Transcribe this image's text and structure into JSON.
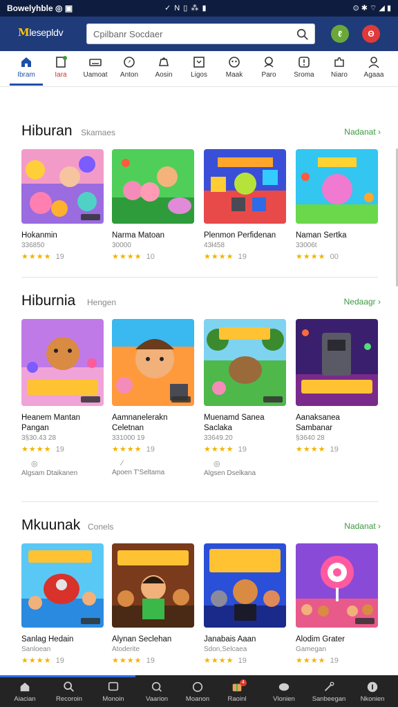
{
  "status_bar": {
    "left": "Bowelyhble ◎ ▣",
    "middle": "✓ N ▯ ⁂ ▮",
    "right": "⊙ ✱ ⌔ ◢ ▮"
  },
  "app_bar": {
    "logo_letters": "M",
    "logo_rest": "lesepldv",
    "search_placeholder": "Cpilbanr Socdaer",
    "right_buttons": [
      "ℓ",
      "Θ"
    ]
  },
  "categories": [
    {
      "label": "Ibram",
      "icon": "home-icon"
    },
    {
      "label": "Iara",
      "icon": "doc-icon"
    },
    {
      "label": "Uamoat",
      "icon": "keyboard-icon"
    },
    {
      "label": "Anton",
      "icon": "compass-icon"
    },
    {
      "label": "Aosin",
      "icon": "bag-icon"
    },
    {
      "label": "Ligos",
      "icon": "grid-icon"
    },
    {
      "label": "Maak",
      "icon": "mask-icon"
    },
    {
      "label": "Paro",
      "icon": "person-icon"
    },
    {
      "label": "Sroma",
      "icon": "info-icon"
    },
    {
      "label": "Niaro",
      "icon": "puzzle-icon"
    },
    {
      "label": "Agaaa",
      "icon": "user-icon"
    }
  ],
  "sections": [
    {
      "title": "Hiburan",
      "subtitle": "Skamaes",
      "more": "Nadanat",
      "cards": [
        {
          "name": "Hokanmin",
          "meta": "336850",
          "stars": "★★★★",
          "rating": "19",
          "art": "pink"
        },
        {
          "name": "Narma Matoan",
          "meta": "30000",
          "stars": "★★★★",
          "rating": "10",
          "art": "green"
        },
        {
          "name": "Plenmon Perfidenan",
          "meta": "43ł458",
          "stars": "★★★★",
          "rating": "19",
          "art": "blocks"
        },
        {
          "name": "Naman Sertka",
          "meta": "33006t",
          "stars": "★★★★",
          "rating": "00",
          "art": "cyan"
        }
      ]
    },
    {
      "title": "Hiburnia",
      "subtitle": "Hengen",
      "more": "Nedaagr",
      "cards": [
        {
          "name": "Heanem Mantan Pangan",
          "meta": "3§30.43 28",
          "stars": "★★★★",
          "rating": "19",
          "art": "bear",
          "foot_icon": "◎",
          "foot": "Algsam Dtaikanen"
        },
        {
          "name": "Aamnanelerakn Celetnan",
          "meta": "331000 19",
          "stars": "★★★★",
          "rating": "19",
          "art": "boy",
          "foot_icon": "⁄",
          "foot": "Apoen T'Seltama"
        },
        {
          "name": "Muenamd Sanea Saclaka",
          "meta": "33649.20",
          "stars": "★★★★",
          "rating": "19",
          "art": "forest",
          "foot_icon": "◎",
          "foot": "Algsen Dselkana"
        },
        {
          "name": "Aanaksanea Sambanar",
          "meta": "§3640 28",
          "stars": "★★★★",
          "rating": "19",
          "art": "robot"
        }
      ]
    },
    {
      "title": "Mkuunak",
      "subtitle": "Conels",
      "more": "Nadanat",
      "cards": [
        {
          "name": "Sanlag Hedain",
          "meta": "Sanloean",
          "stars": "★★★★",
          "rating": "19",
          "art": "drum"
        },
        {
          "name": "Alynan Seclehan",
          "meta": "Atoderite",
          "stars": "★★★★",
          "rating": "19",
          "art": "crowd"
        },
        {
          "name": "Janabais Aaan",
          "meta": "Sdon,Selcaea",
          "stars": "★★★★",
          "rating": "19",
          "art": "band"
        },
        {
          "name": "Alodim Grater",
          "meta": "Gamegan",
          "stars": "★★★★",
          "rating": "19",
          "art": "candy"
        }
      ]
    }
  ],
  "bottom_nav": [
    {
      "label": "Aiacian",
      "icon": "home-icon"
    },
    {
      "label": "Recoroin",
      "icon": "search-icon"
    },
    {
      "label": "Monoin",
      "icon": "monitor-icon"
    },
    {
      "label": "Vaarion",
      "icon": "magnifier-icon"
    },
    {
      "label": "Moanon",
      "icon": "chat-icon"
    },
    {
      "label": "Raoinl",
      "icon": "gift-icon",
      "badge": "4"
    },
    {
      "label": "Vlonien",
      "icon": "play-icon"
    },
    {
      "label": "Sanbeegan",
      "icon": "pen-icon"
    },
    {
      "label": "Nkonien",
      "icon": "media-icon"
    }
  ],
  "colors": {
    "primary": "#1f3b7a",
    "accent": "#1d4fa8",
    "more_link": "#3a9a3f",
    "star": "#f2b300"
  }
}
